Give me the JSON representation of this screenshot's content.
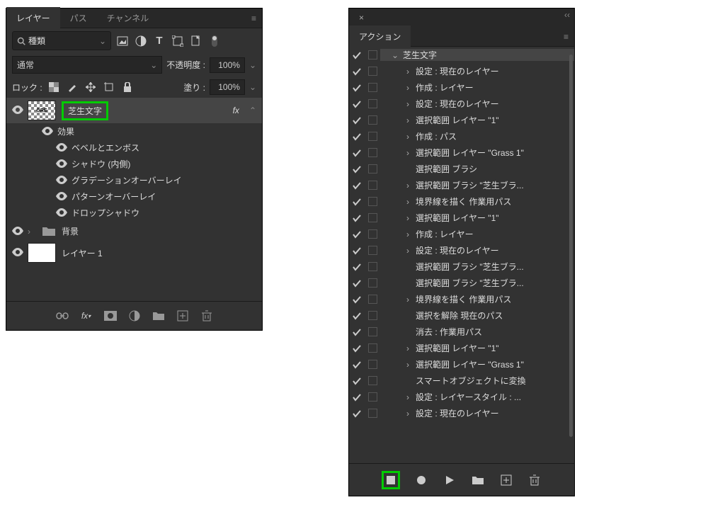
{
  "layers_panel": {
    "tabs": [
      "レイヤー",
      "パス",
      "チャンネル"
    ],
    "search_placeholder": "種類",
    "blend_mode": "通常",
    "opacity_label": "不透明度 :",
    "opacity": "100%",
    "lock_label": "ロック :",
    "fill_label": "塗り :",
    "fill": "100%",
    "layers": [
      {
        "name": "芝生文字",
        "fx": "fx",
        "thumb_text": "GRE"
      },
      {
        "name": "効果"
      },
      {
        "name": "ベベルとエンボス"
      },
      {
        "name": "シャドウ (内側)"
      },
      {
        "name": "グラデーションオーバーレイ"
      },
      {
        "name": "パターンオーバーレイ"
      },
      {
        "name": "ドロップシャドウ"
      }
    ],
    "folder_layer": "背景",
    "plain_layer": "レイヤー 1"
  },
  "actions_panel": {
    "title": "アクション",
    "items": [
      {
        "depth": 1,
        "chev": "v",
        "label": "芝生文字",
        "selected": true
      },
      {
        "depth": 2,
        "chev": ">",
        "label": "設定 :  現在のレイヤー"
      },
      {
        "depth": 2,
        "chev": ">",
        "label": "作成 : レイヤー"
      },
      {
        "depth": 2,
        "chev": ">",
        "label": "設定 :  現在のレイヤー"
      },
      {
        "depth": 2,
        "chev": ">",
        "label": "選択範囲 レイヤー \"1\""
      },
      {
        "depth": 2,
        "chev": ">",
        "label": "作成 : パス"
      },
      {
        "depth": 2,
        "chev": ">",
        "label": "選択範囲 レイヤー \"Grass 1\""
      },
      {
        "depth": 2,
        "chev": "",
        "label": "選択範囲 ブラシ"
      },
      {
        "depth": 2,
        "chev": ">",
        "label": "選択範囲 ブラシ \"芝生ブラ..."
      },
      {
        "depth": 2,
        "chev": ">",
        "label": "境界線を描く 作業用パス"
      },
      {
        "depth": 2,
        "chev": ">",
        "label": "選択範囲 レイヤー \"1\""
      },
      {
        "depth": 2,
        "chev": ">",
        "label": "作成 : レイヤー"
      },
      {
        "depth": 2,
        "chev": ">",
        "label": "設定 :  現在のレイヤー"
      },
      {
        "depth": 2,
        "chev": "",
        "label": "選択範囲 ブラシ \"芝生ブラ..."
      },
      {
        "depth": 2,
        "chev": "",
        "label": "選択範囲 ブラシ \"芝生ブラ..."
      },
      {
        "depth": 2,
        "chev": ">",
        "label": "境界線を描く 作業用パス"
      },
      {
        "depth": 2,
        "chev": "",
        "label": "選択を解除  現在のパス"
      },
      {
        "depth": 2,
        "chev": "",
        "label": "消去 : 作業用パス"
      },
      {
        "depth": 2,
        "chev": ">",
        "label": "選択範囲 レイヤー \"1\""
      },
      {
        "depth": 2,
        "chev": ">",
        "label": "選択範囲 レイヤー \"Grass 1\""
      },
      {
        "depth": 2,
        "chev": "",
        "label": "スマートオブジェクトに変換"
      },
      {
        "depth": 2,
        "chev": ">",
        "label": "設定 : レイヤースタイル :  ..."
      },
      {
        "depth": 2,
        "chev": ">",
        "label": "設定 :  現在のレイヤー"
      }
    ]
  }
}
